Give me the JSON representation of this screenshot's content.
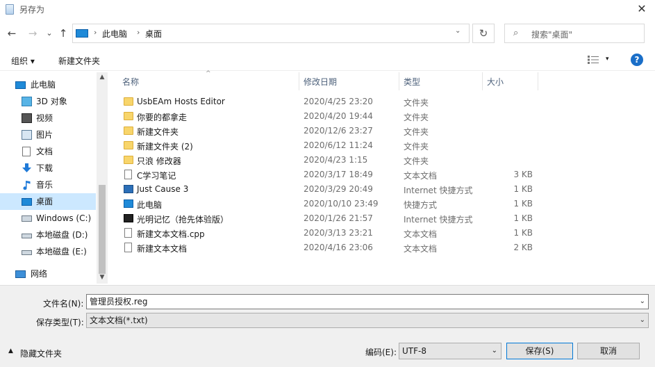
{
  "window": {
    "title": "另存为",
    "close_glyph": "✕"
  },
  "nav_buttons": {
    "back": "←",
    "forward": "→",
    "recent": "⌄",
    "up": "↑"
  },
  "address": {
    "segments": [
      "此电脑",
      "桌面"
    ],
    "separator": "›",
    "dropdown": "⌄",
    "refresh": "↻"
  },
  "search": {
    "placeholder": "搜索\"桌面\"",
    "icon": "search-icon"
  },
  "toolbar": {
    "organize": "组织 ▾",
    "new_folder": "新建文件夹",
    "view_dropdown": "▾",
    "help": "?"
  },
  "nav": {
    "items": [
      {
        "label": "此电脑",
        "icon": "pc-icon"
      },
      {
        "label": "3D 对象",
        "icon": "3d-objects-icon"
      },
      {
        "label": "视频",
        "icon": "video-icon"
      },
      {
        "label": "图片",
        "icon": "pictures-icon"
      },
      {
        "label": "文档",
        "icon": "documents-icon"
      },
      {
        "label": "下载",
        "icon": "download-icon"
      },
      {
        "label": "音乐",
        "icon": "music-icon"
      },
      {
        "label": "桌面",
        "icon": "desktop-icon",
        "selected": true
      },
      {
        "label": "Windows (C:)",
        "icon": "drive-icon"
      },
      {
        "label": "本地磁盘 (D:)",
        "icon": "drive-icon"
      },
      {
        "label": "本地磁盘 (E:)",
        "icon": "drive-icon"
      },
      {
        "label": "网络",
        "icon": "network-icon"
      }
    ],
    "scroll_up": "▲",
    "scroll_down": "▼"
  },
  "columns": {
    "name": "名称",
    "date": "修改日期",
    "type": "类型",
    "size": "大小",
    "sort_glyph": "^"
  },
  "files": [
    {
      "name": "UsbEAm Hosts Editor",
      "date": "2020/4/25 23:20",
      "type": "文件夹",
      "size": "",
      "icon": "folder-icon"
    },
    {
      "name": "你要的都拿走",
      "date": "2020/4/20 19:44",
      "type": "文件夹",
      "size": "",
      "icon": "folder-icon"
    },
    {
      "name": "新建文件夹",
      "date": "2020/12/6 23:27",
      "type": "文件夹",
      "size": "",
      "icon": "folder-icon"
    },
    {
      "name": "新建文件夹 (2)",
      "date": "2020/6/12 11:24",
      "type": "文件夹",
      "size": "",
      "icon": "folder-icon"
    },
    {
      "name": "只浪 修改器",
      "date": "2020/4/23 1:15",
      "type": "文件夹",
      "size": "",
      "icon": "folder-icon"
    },
    {
      "name": "C学习笔记",
      "date": "2020/3/17 18:49",
      "type": "文本文档",
      "size": "3 KB",
      "icon": "text-file-icon"
    },
    {
      "name": "Just Cause 3",
      "date": "2020/3/29 20:49",
      "type": "Internet 快捷方式",
      "size": "1 KB",
      "icon": "shortcut-icon"
    },
    {
      "name": "此电脑",
      "date": "2020/10/10 23:49",
      "type": "快捷方式",
      "size": "1 KB",
      "icon": "pc-shortcut-icon"
    },
    {
      "name": "光明记忆（抢先体验版）",
      "date": "2020/1/26 21:57",
      "type": "Internet 快捷方式",
      "size": "1 KB",
      "icon": "shortcut-icon"
    },
    {
      "name": "新建文本文档.cpp",
      "date": "2020/3/13 23:21",
      "type": "文本文档",
      "size": "1 KB",
      "icon": "text-file-icon"
    },
    {
      "name": "新建文本文档",
      "date": "2020/4/16 23:06",
      "type": "文本文档",
      "size": "2 KB",
      "icon": "text-file-icon"
    }
  ],
  "bottom": {
    "filename_label": "文件名(N):",
    "filename_value": "管理员授权.reg",
    "filetype_label": "保存类型(T):",
    "filetype_value": "文本文档(*.txt)",
    "dropdown_glyph": "⌄",
    "hide_folders_chevron": "▲",
    "hide_folders": "隐藏文件夹",
    "encoding_label": "编码(E):",
    "encoding_value": "UTF-8",
    "save": "保存(S)",
    "cancel": "取消"
  },
  "colors": {
    "selection": "#cce8ff",
    "accent": "#0078d7",
    "folder": "#f8d56b"
  }
}
